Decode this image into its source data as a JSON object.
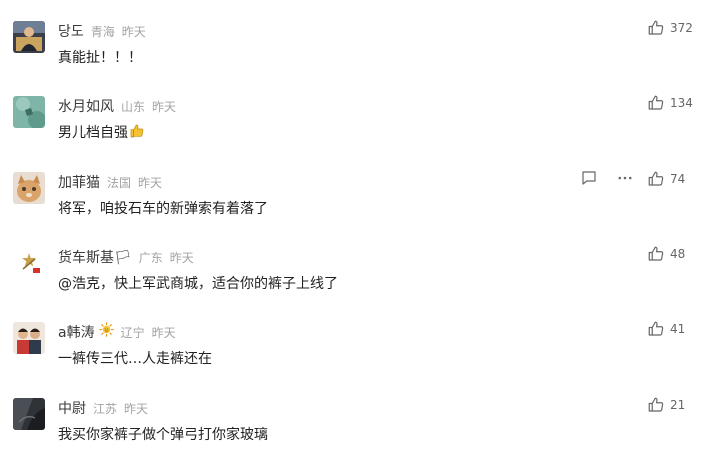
{
  "comments": [
    {
      "name": "당도",
      "location": "青海",
      "time": "昨天",
      "text": "真能扯！！！",
      "likes": "372"
    },
    {
      "name": "水月如风",
      "location": "山东",
      "time": "昨天",
      "text": "男儿档自强",
      "likes": "134"
    },
    {
      "name": "加菲猫",
      "location": "法国",
      "time": "昨天",
      "text": "将军，咱投石车的新弹索有着落了",
      "likes": "74"
    },
    {
      "name": "货车斯基🏳",
      "location": "广东",
      "time": "昨天",
      "text": "@浩克，快上军武商城，适合你的裤子上线了",
      "likes": "48"
    },
    {
      "name": "a韩涛",
      "location": "辽宁",
      "time": "昨天",
      "text": "一裤传三代…人走裤还在",
      "likes": "41"
    },
    {
      "name": "中尉",
      "location": "江苏",
      "time": "昨天",
      "text": "我买你家裤子做个弹弓打你家玻璃",
      "likes": "21"
    }
  ],
  "icons": {
    "like": "thumbs-up-icon",
    "reply": "comment-bubble-icon",
    "more": "more-dots-icon",
    "sun_badge": "sun-badge-icon",
    "thumb_emoji": "thumbs-up-emoji-icon"
  },
  "colors": {
    "meta_gray": "#a3a3a3",
    "text": "#222222",
    "icon_gray": "#666666",
    "emoji_yellow": "#f6c234"
  }
}
